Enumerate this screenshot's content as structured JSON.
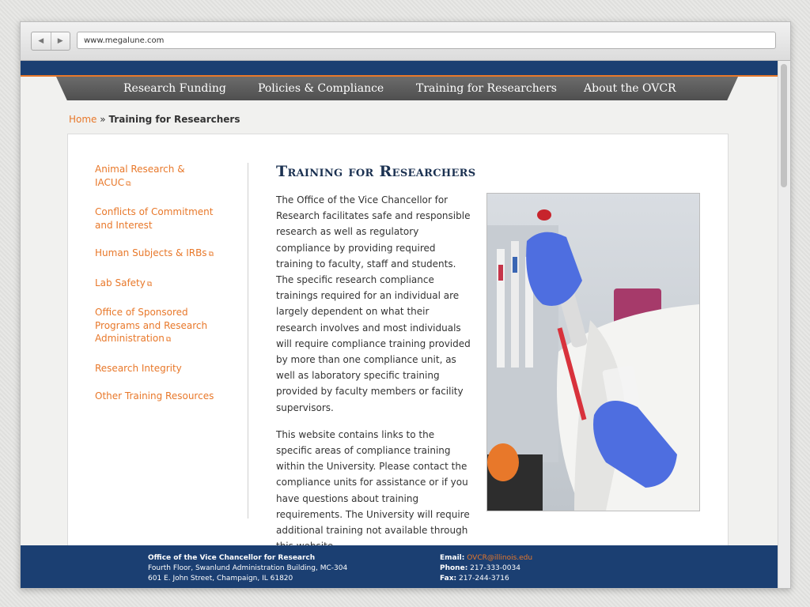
{
  "browser": {
    "url": "www.megalune.com",
    "back_icon": "◀",
    "forward_icon": "▶"
  },
  "nav": {
    "items": [
      {
        "label": "Research Funding"
      },
      {
        "label": "Policies & Compliance"
      },
      {
        "label": "Training for Researchers"
      },
      {
        "label": "About the OVCR"
      }
    ]
  },
  "breadcrumb": {
    "home": "Home",
    "separator": "»",
    "current": "Training for Researchers"
  },
  "sidebar": {
    "items": [
      {
        "label": "Animal Research & IACUC",
        "external": true
      },
      {
        "label": "Conflicts of Commitment and Interest",
        "external": false
      },
      {
        "label": "Human Subjects & IRBs",
        "external": true
      },
      {
        "label": "Lab Safety",
        "external": true
      },
      {
        "label": "Office of Sponsored Programs and Research Administration",
        "external": true
      },
      {
        "label": "Research Integrity",
        "external": false
      },
      {
        "label": "Other Training Resources",
        "external": false
      }
    ],
    "external_icon": "⧉"
  },
  "main": {
    "title": "Training for Researchers",
    "paragraph1": "The Office of the Vice Chancellor for Research facilitates safe and responsible research as well as regulatory compliance by providing required training to faculty, staff and students. The specific research compliance trainings required for an individual are largely dependent on what their research involves and most individuals will require compliance training provided by more than one compliance unit, as well as laboratory specific training provided by faculty members or facility supervisors.",
    "paragraph2": "This website contains links to the specific areas of compliance training within the University. Please contact the compliance units for assistance or if you have questions about training requirements. The University will require additional training not available through this website ."
  },
  "footer": {
    "org": "Office of the Vice Chancellor for Research",
    "address1": "Fourth Floor, Swanlund Administration Building, MC-304",
    "address2": "601 E. John Street, Champaign, IL 61820",
    "email_label": "Email:",
    "email": "OVCR@illinois.edu",
    "phone_label": "Phone:",
    "phone": "217-333-0034",
    "fax_label": "Fax:",
    "fax": "217-244-3716"
  },
  "colors": {
    "accent": "#e8782a",
    "navy": "#1b3f72",
    "menu": "#5a5a5a"
  }
}
